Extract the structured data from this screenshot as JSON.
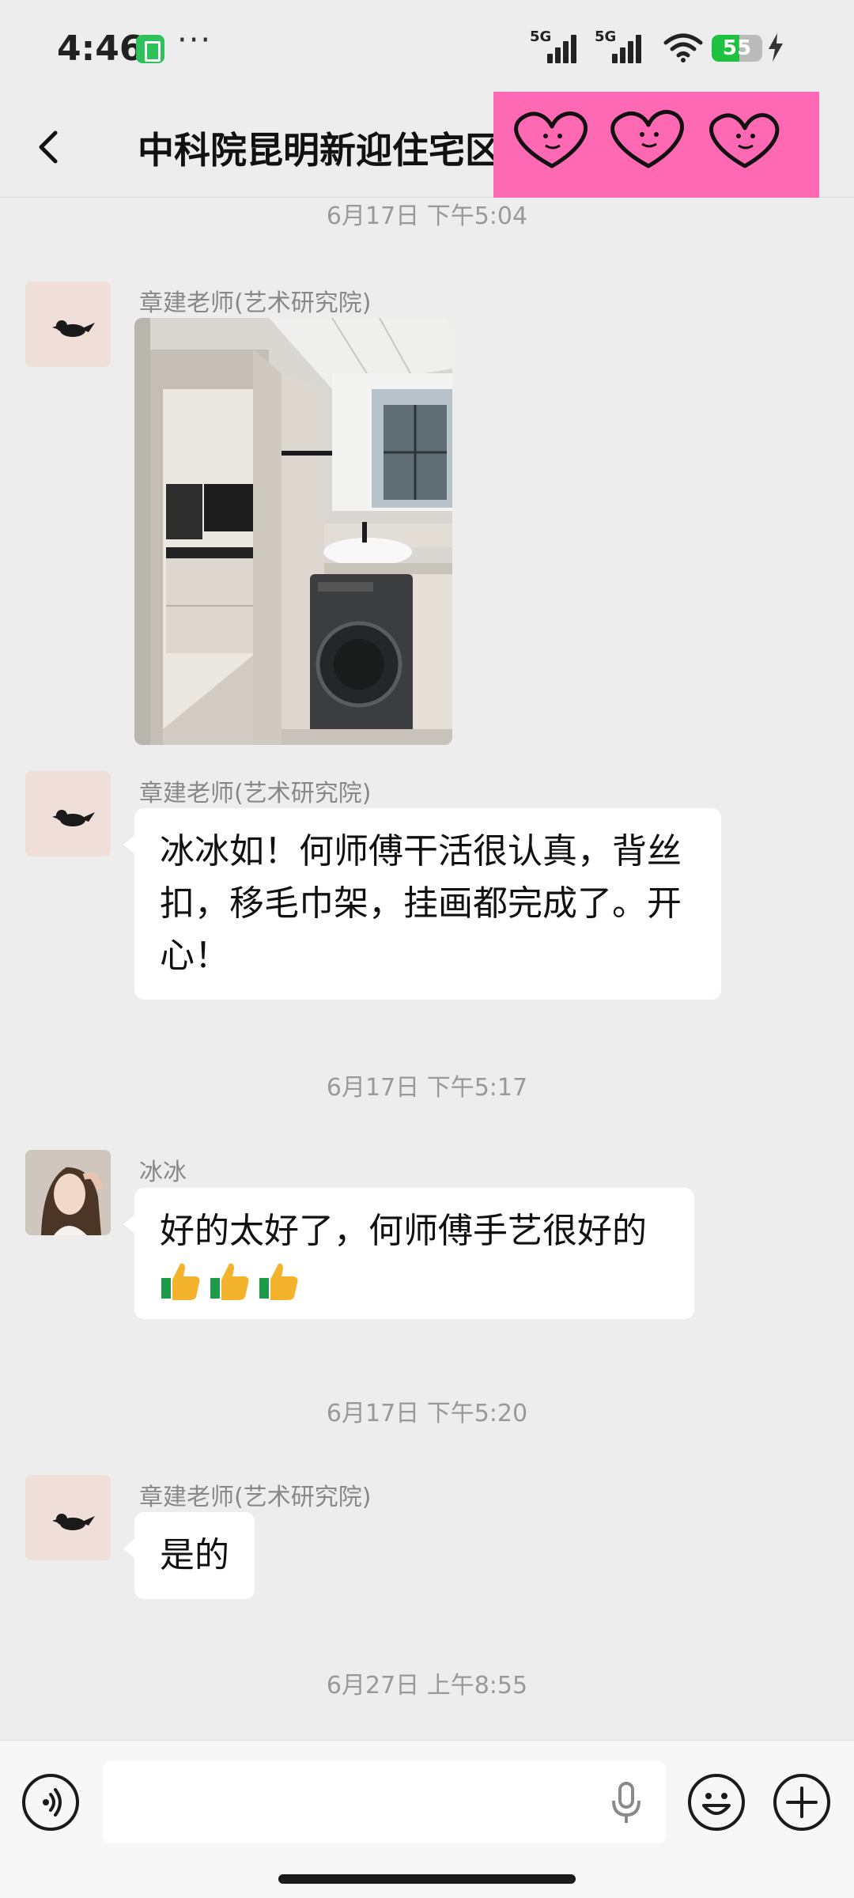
{
  "status_bar": {
    "time": "4:46",
    "signal_1_label": "5G",
    "signal_2_label": "5G",
    "battery_level": "55",
    "battery_fraction": 0.55,
    "icons": [
      "app-notification-icon",
      "more-dots-icon",
      "signal-icon",
      "wifi-icon",
      "battery-icon",
      "charging-icon"
    ]
  },
  "header": {
    "title": "中科院昆明新迎住宅区",
    "back_icon": "chevron-left-icon",
    "sticker": "three-hearts-sticker"
  },
  "messages": [
    {
      "type": "timestamp",
      "text": "6月17日 下午5:04"
    },
    {
      "type": "image",
      "sender": "章建老师(艺术研究院)",
      "avatar": "bird-avatar",
      "image": "bathroom-laundry-photo"
    },
    {
      "type": "text",
      "sender": "章建老师(艺术研究院)",
      "avatar": "bird-avatar",
      "lines": [
        "冰冰如！何师傅干活很认真，背丝",
        "扣，移毛巾架，挂画都完成了。开",
        "心！"
      ]
    },
    {
      "type": "timestamp",
      "text": "6月17日 下午5:17"
    },
    {
      "type": "text",
      "sender": "冰冰",
      "avatar": "person-avatar",
      "lines": [
        "好的太好了，何师傅手艺很好的"
      ],
      "emoji": [
        "thumbs-up-icon",
        "thumbs-up-icon",
        "thumbs-up-icon"
      ]
    },
    {
      "type": "timestamp",
      "text": "6月17日 下午5:20"
    },
    {
      "type": "text",
      "sender": "章建老师(艺术研究院)",
      "avatar": "bird-avatar",
      "lines": [
        "是的"
      ]
    },
    {
      "type": "timestamp",
      "text": "6月27日 上午8:55"
    }
  ],
  "input_bar": {
    "value": "",
    "icons": [
      "voice-icon",
      "mic-icon",
      "emoji-icon",
      "plus-icon"
    ]
  },
  "colors": {
    "background": "#ededed",
    "bubble": "#ffffff",
    "sticker_pink": "#ff69b4",
    "battery_green": "#1fc141",
    "timestamp_gray": "#999999"
  }
}
